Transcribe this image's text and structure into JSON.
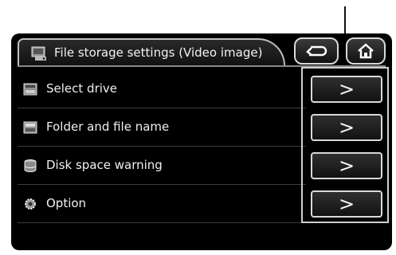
{
  "header": {
    "title": "File storage settings (Video image)",
    "title_icon": "folder-settings-icon",
    "back_icon": "return-arrow-icon",
    "home_icon": "home-icon"
  },
  "rows": [
    {
      "label": "Select drive",
      "icon": "drive-icon",
      "action": ">"
    },
    {
      "label": "Folder and file name",
      "icon": "folder-icon",
      "action": ">"
    },
    {
      "label": "Disk space warning",
      "icon": "disk-icon",
      "action": ">"
    },
    {
      "label": "Option",
      "icon": "gear-icon",
      "action": ">"
    }
  ],
  "colors": {
    "background": "#000000",
    "text": "#f0f0f0",
    "button_border": "#d8d8d8"
  }
}
